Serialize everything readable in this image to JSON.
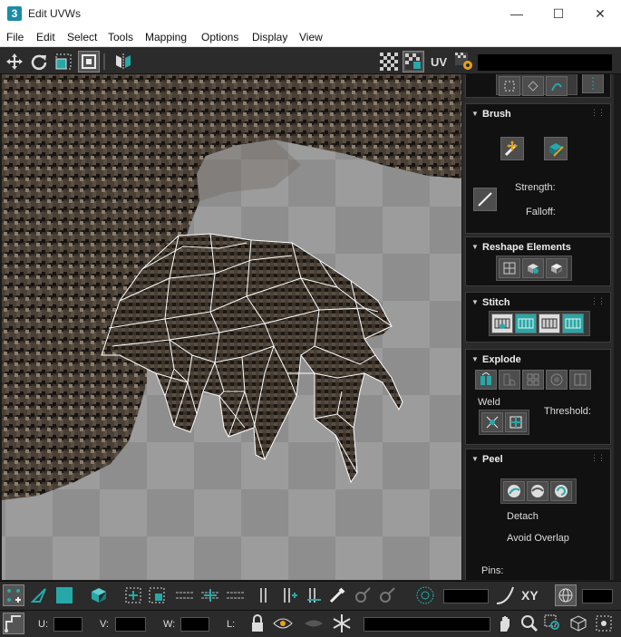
{
  "window": {
    "app_icon_label": "3",
    "title": "Edit UVWs",
    "controls": {
      "minimize": "—",
      "maximize": "☐",
      "close": "✕"
    }
  },
  "menu": [
    "File",
    "Edit",
    "Select",
    "Tools",
    "Mapping",
    "Options",
    "Display",
    "View"
  ],
  "toolbar": {
    "uv_label": "UV",
    "icons": [
      "move-icon",
      "rotate-icon",
      "scale-icon",
      "freeform-icon",
      "mirror-icon",
      "checker-icon",
      "checker-map-icon",
      "uv-label",
      "settings-icon"
    ]
  },
  "panel": {
    "brush": {
      "title": "Brush",
      "strength_label": "Strength:",
      "falloff_label": "Falloff:"
    },
    "reshape": {
      "title": "Reshape Elements"
    },
    "stitch": {
      "title": "Stitch"
    },
    "explode": {
      "title": "Explode",
      "weld_label": "Weld",
      "threshold_label": "Threshold:"
    },
    "peel": {
      "title": "Peel",
      "detach_label": "Detach",
      "avoid_overlap_label": "Avoid Overlap",
      "pins_label": "Pins:"
    }
  },
  "bottom": {
    "xy_label": "XY",
    "u_label": "U:",
    "v_label": "V:",
    "w_label": "W:",
    "l_label": "L:"
  },
  "colors": {
    "accent_teal": "#27a8a8",
    "panel_bg": "#111111",
    "toolbar_bg": "#2b2b2b",
    "wire": "#ffffff"
  }
}
